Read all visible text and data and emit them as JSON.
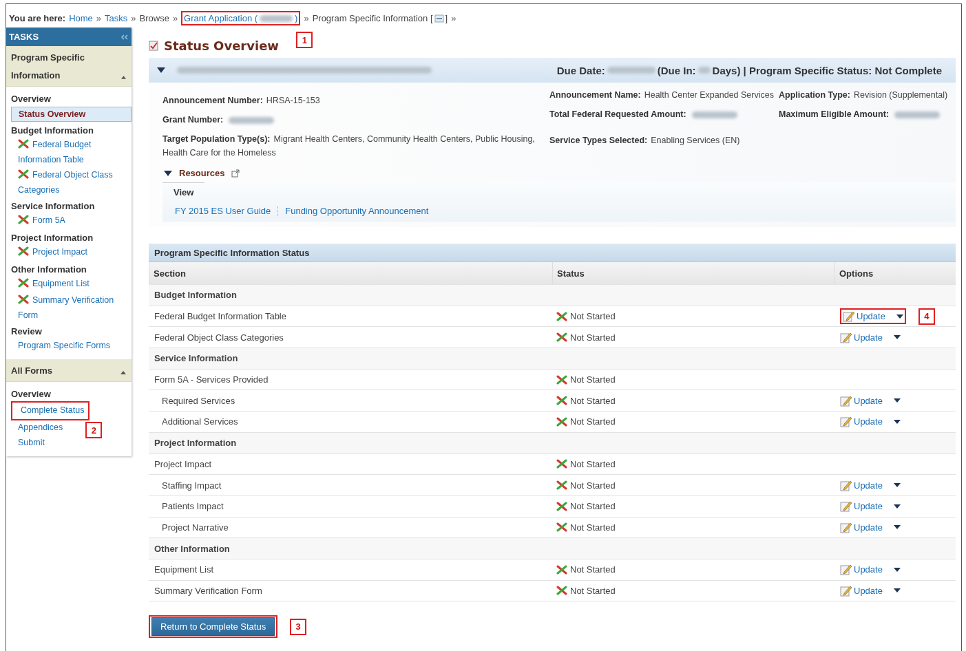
{
  "breadcrumb": {
    "label": "You are here:",
    "separator": "»",
    "items": [
      {
        "text": "Home",
        "kind": "link"
      },
      {
        "text": "Tasks",
        "kind": "link"
      },
      {
        "text": "Browse",
        "kind": "plain"
      },
      {
        "text": "Grant Application (",
        "tail": ")",
        "kind": "link",
        "blurred": true,
        "callout": "1"
      },
      {
        "text": "Program Specific Information [",
        "tail": "]",
        "kind": "plain",
        "icon": true
      }
    ]
  },
  "sidebar": {
    "title": "TASKS",
    "panels": [
      {
        "title": "Program Specific Information",
        "expanded": true,
        "groups": [
          {
            "heading": "Overview",
            "items": [
              {
                "text": "Status Overview",
                "selected": true,
                "incomplete": false
              }
            ]
          },
          {
            "heading": "Budget Information",
            "items": [
              {
                "text": "Federal Budget Information Table",
                "selected": false,
                "incomplete": true
              },
              {
                "text": "Federal Object Class Categories",
                "selected": false,
                "incomplete": true
              }
            ]
          },
          {
            "heading": "Service Information",
            "items": [
              {
                "text": "Form 5A",
                "selected": false,
                "incomplete": true
              }
            ]
          },
          {
            "heading": "Project Information",
            "items": [
              {
                "text": "Project Impact",
                "selected": false,
                "incomplete": true
              }
            ]
          },
          {
            "heading": "Other Information",
            "items": [
              {
                "text": "Equipment List",
                "selected": false,
                "incomplete": true
              },
              {
                "text": "Summary Verification Form",
                "selected": false,
                "incomplete": true
              }
            ]
          },
          {
            "heading": "Review",
            "items": [
              {
                "text": "Program Specific Forms",
                "selected": false,
                "incomplete": false
              }
            ]
          }
        ]
      },
      {
        "title": "All Forms",
        "expanded": true,
        "groups": [
          {
            "heading": "Overview",
            "items": [
              {
                "text": "Complete Status",
                "selected": false,
                "incomplete": false,
                "callout": "2"
              },
              {
                "text": "Appendices",
                "selected": false,
                "incomplete": false
              },
              {
                "text": "Submit",
                "selected": false,
                "incomplete": false
              }
            ]
          }
        ]
      }
    ]
  },
  "page_title": "Status Overview",
  "header": {
    "expanded": true,
    "due_parts": [
      "Due Date:",
      "(Due In:",
      "Days) | Program Specific Status: Not Complete"
    ]
  },
  "details": {
    "columns": [
      [
        {
          "label": "Announcement Number:",
          "value": "HRSA-15-153"
        },
        {
          "label": "Grant Number:",
          "blurred": true
        },
        {
          "label": "Target Population Type(s):",
          "value": "Migrant Health Centers, Community Health Centers, Public Housing, Health Care for the Homeless"
        }
      ],
      [
        {
          "label": "Announcement Name:",
          "value": "Health Center Expanded Services"
        },
        {
          "label": "Total Federal Requested Amount:",
          "blurred": true
        },
        {
          "label": "Service Types Selected:",
          "value": "Enabling Services (EN)"
        }
      ],
      [
        {
          "label": "Application Type:",
          "value": "Revision (Supplemental)"
        },
        {
          "label": "Maximum Eligible Amount:",
          "blurred": true
        }
      ]
    ]
  },
  "resources": {
    "title": "Resources",
    "expanded": true,
    "tab": "View",
    "links": [
      "FY 2015 ES User Guide",
      "Funding Opportunity Announcement"
    ]
  },
  "table": {
    "title": "Program Specific Information Status",
    "columns": [
      "Section",
      "Status",
      "Options"
    ],
    "rows": [
      {
        "kind": "group",
        "section": "Budget Information"
      },
      {
        "kind": "item",
        "section": "Federal Budget Information Table",
        "status": "Not Started",
        "indented": false,
        "update": "Update",
        "callout": "4"
      },
      {
        "kind": "item",
        "section": "Federal Object Class Categories",
        "status": "Not Started",
        "indented": false,
        "update": "Update"
      },
      {
        "kind": "group",
        "section": "Service Information"
      },
      {
        "kind": "item",
        "section": "Form 5A - Services Provided",
        "status": "Not Started",
        "indented": false
      },
      {
        "kind": "item",
        "section": "Required Services",
        "status": "Not Started",
        "indented": true,
        "update": "Update"
      },
      {
        "kind": "item",
        "section": "Additional Services",
        "status": "Not Started",
        "indented": true,
        "update": "Update"
      },
      {
        "kind": "group",
        "section": "Project Information"
      },
      {
        "kind": "item",
        "section": "Project Impact",
        "status": "Not Started",
        "indented": false
      },
      {
        "kind": "item",
        "section": "Staffing Impact",
        "status": "Not Started",
        "indented": true,
        "update": "Update"
      },
      {
        "kind": "item",
        "section": "Patients Impact",
        "status": "Not Started",
        "indented": true,
        "update": "Update"
      },
      {
        "kind": "item",
        "section": "Project Narrative",
        "status": "Not Started",
        "indented": true,
        "update": "Update"
      },
      {
        "kind": "group",
        "section": "Other Information"
      },
      {
        "kind": "item",
        "section": "Equipment List",
        "status": "Not Started",
        "indented": false,
        "update": "Update"
      },
      {
        "kind": "item",
        "section": "Summary Verification Form",
        "status": "Not Started",
        "indented": false,
        "update": "Update"
      }
    ]
  },
  "return_button": {
    "label": "Return to Complete Status",
    "callout": "3"
  }
}
